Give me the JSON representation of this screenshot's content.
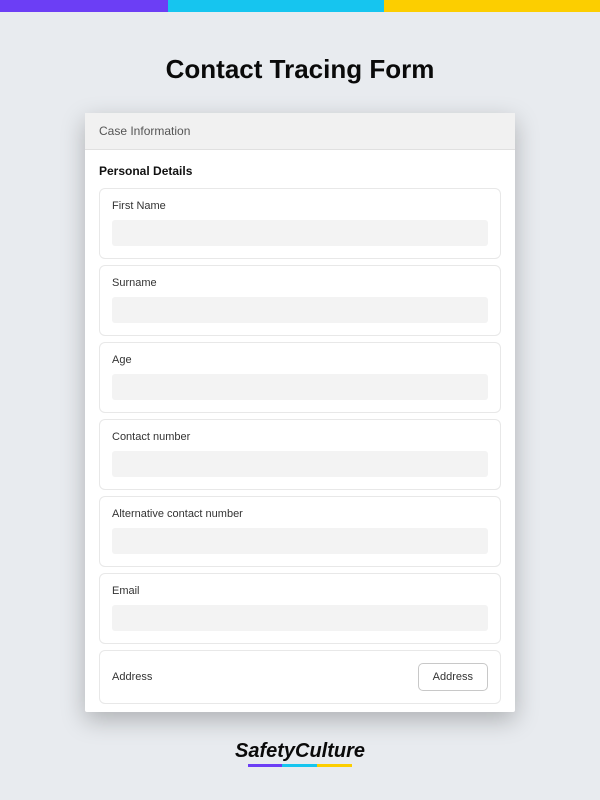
{
  "page": {
    "title": "Contact Tracing Form"
  },
  "form": {
    "section_header": "Case Information",
    "subsection_title": "Personal Details",
    "fields": {
      "first_name": {
        "label": "First Name",
        "value": ""
      },
      "surname": {
        "label": "Surname",
        "value": ""
      },
      "age": {
        "label": "Age",
        "value": ""
      },
      "contact_number": {
        "label": "Contact number",
        "value": ""
      },
      "alt_contact_number": {
        "label": "Alternative contact number",
        "value": ""
      },
      "email": {
        "label": "Email",
        "value": ""
      },
      "address": {
        "label": "Address",
        "button_label": "Address"
      }
    }
  },
  "brand": {
    "name": "SafetyCulture"
  },
  "colors": {
    "purple": "#6c3ef5",
    "cyan": "#16c5ef",
    "yellow": "#fcce00"
  }
}
